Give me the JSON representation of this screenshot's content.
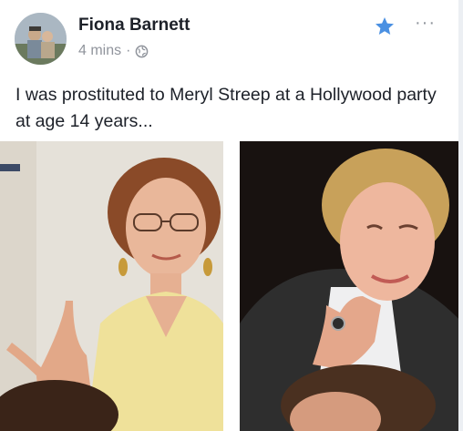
{
  "post": {
    "author": "Fiona Barnett",
    "time": "4 mins",
    "separator": "·",
    "privacy_icon": "globe-icon",
    "actions": {
      "favorite_icon": "star-icon",
      "more_label": "···"
    },
    "text": "I was prostituted to Meryl Streep at a Hollywood party at age 14 years...",
    "photos": [
      {
        "name": "left-photo"
      },
      {
        "name": "right-photo"
      }
    ]
  },
  "colors": {
    "accent_blue": "#4a90e2",
    "meta_gray": "#90949c",
    "text": "#1d2129"
  }
}
